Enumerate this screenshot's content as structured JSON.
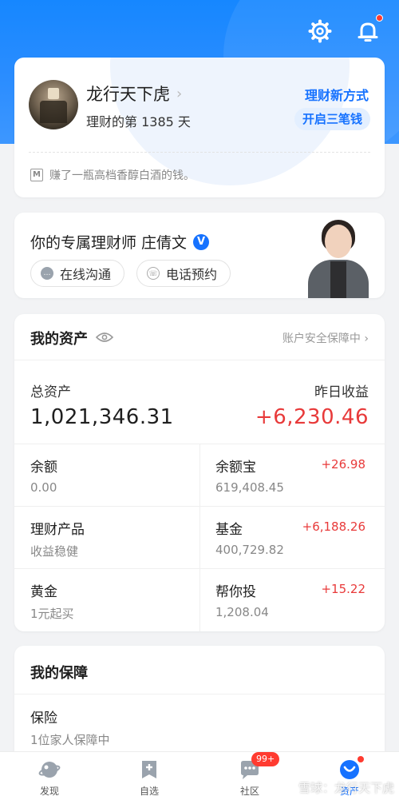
{
  "header": {
    "icons": [
      "gear-icon",
      "bell-icon"
    ],
    "bell_has_dot": true
  },
  "profile": {
    "nickname": "龙行天下虎",
    "days_text": "理财的第 1385 天",
    "promo_title": "理财新方式",
    "promo_pill": "开启三笔钱",
    "quote": "赚了一瓶高档香醇白酒的钱。"
  },
  "advisor": {
    "title": "你的专属理财师 庄倩文",
    "verified_mark": "V",
    "online_btn": "在线沟通",
    "phone_btn": "电话预约"
  },
  "assets": {
    "title": "我的资产",
    "safety": "账户安全保障中",
    "total_label": "总资产",
    "total_value": "1,021,346.31",
    "yesterday_label": "昨日收益",
    "yesterday_value": "+6,230.46",
    "items": [
      {
        "name": "余额",
        "sub": "0.00",
        "delta": ""
      },
      {
        "name": "余额宝",
        "sub": "619,408.45",
        "delta": "+26.98"
      },
      {
        "name": "理财产品",
        "sub": "收益稳健",
        "delta": ""
      },
      {
        "name": "基金",
        "sub": "400,729.82",
        "delta": "+6,188.26"
      },
      {
        "name": "黄金",
        "sub": "1元起买",
        "delta": ""
      },
      {
        "name": "帮你投",
        "sub": "1,208.04",
        "delta": "+15.22"
      }
    ]
  },
  "protection": {
    "title": "我的保障",
    "item_name": "保险",
    "item_sub": "1位家人保障中"
  },
  "tabbar": {
    "tabs": [
      {
        "label": "发现",
        "icon": "planet-icon"
      },
      {
        "label": "自选",
        "icon": "bookmark-plus-icon"
      },
      {
        "label": "社区",
        "icon": "chat-icon",
        "badge": "99+"
      },
      {
        "label": "资产",
        "icon": "assets-icon",
        "active": true
      }
    ]
  },
  "watermark": "雪球：龙行天下虎",
  "colors": {
    "brand_blue": "#1672ff",
    "gain_red": "#e83a3a",
    "header_blue": "#1687ff"
  }
}
